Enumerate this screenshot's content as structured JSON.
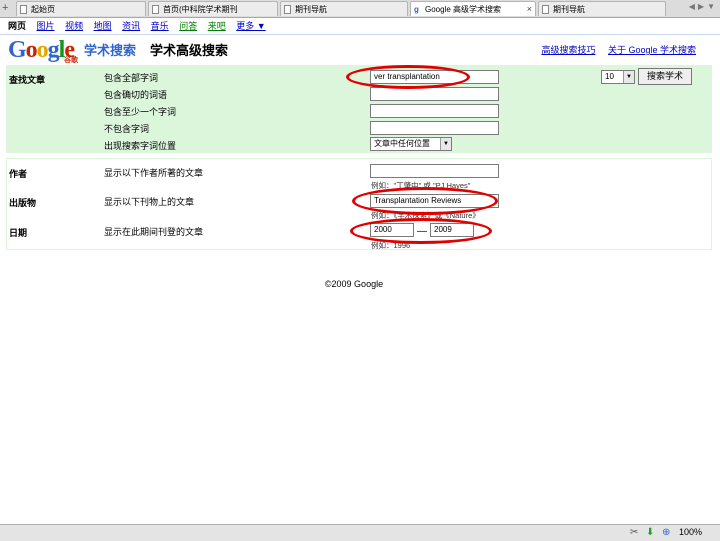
{
  "tabs": [
    {
      "label": "起始页",
      "active": false
    },
    {
      "label": "首页(中科院学术期刊",
      "active": false
    },
    {
      "label": "期刊导航",
      "active": false
    },
    {
      "label": "Google 高级学术搜索",
      "active": true
    },
    {
      "label": "期刊导航",
      "active": false
    }
  ],
  "gnav": [
    "网页",
    "图片",
    "视频",
    "地图",
    "资讯",
    "音乐",
    "问答",
    "来吧",
    "更多 ▼"
  ],
  "header": {
    "logo_letters": [
      "G",
      "o",
      "o",
      "g",
      "l",
      "e"
    ],
    "logo_sub": "谷歌",
    "product": "学术搜索",
    "page_title": "学术高级搜索",
    "links": [
      "高级搜索技巧",
      "关于 Google 学术搜索"
    ]
  },
  "find": {
    "section_label": "查找文章",
    "rows": [
      {
        "label": "包含全部字词",
        "value": "ver transplantation"
      },
      {
        "label": "包含确切的词语",
        "value": ""
      },
      {
        "label": "包含至少一个字词",
        "value": ""
      },
      {
        "label": "不包含字词",
        "value": ""
      },
      {
        "label": "出现搜索字词位置",
        "value": "文章中任何位置"
      }
    ],
    "results_select": "10",
    "search_button": "搜索学术"
  },
  "author": {
    "section_label": "作者",
    "label": "显示以下作者所著的文章",
    "value": "",
    "hint": "例如：\"丁肇中\" 或 \"PJ Hayes\""
  },
  "publication": {
    "section_label": "出版物",
    "label": "显示以下刊物上的文章",
    "value": "Transplantation Reviews",
    "hint": "例如：《学术探索》或《Nature》"
  },
  "date": {
    "section_label": "日期",
    "label": "显示在此期间刊登的文章",
    "from": "2000",
    "sep": "—",
    "to": "2009",
    "hint": "例如：1996"
  },
  "footer": {
    "copyright": "©2009 Google"
  },
  "status": {
    "zoom": "100%"
  }
}
